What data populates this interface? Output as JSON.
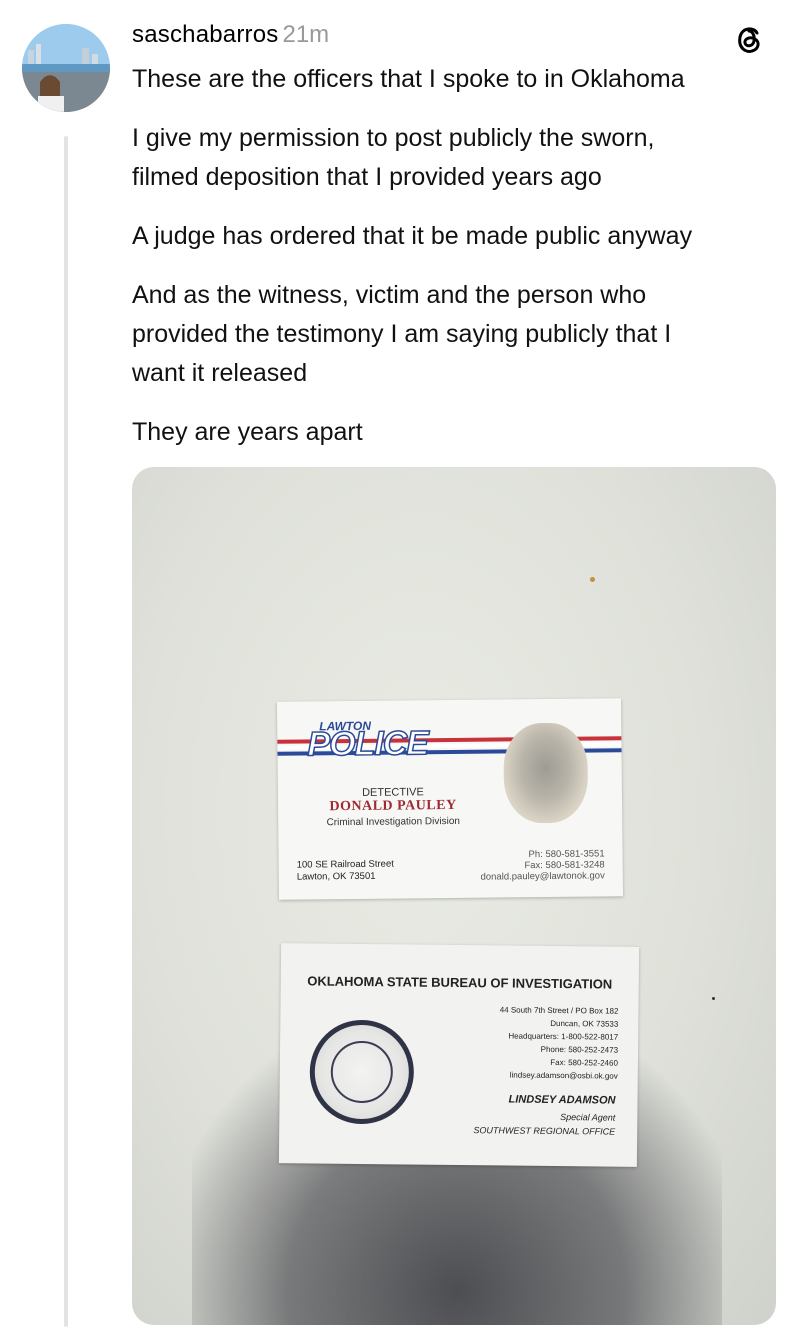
{
  "post": {
    "username": "saschabarros",
    "time": "21m",
    "paragraphs": [
      "These are the officers that I spoke to in Oklahoma",
      "I give my permission to post publicly the sworn,\nfilmed deposition that I provided years ago",
      "A judge has ordered that it be made public anyway",
      "And as the witness, victim and the person who\nprovided the testimony I am saying publicly that I\nwant it released",
      "They are years apart"
    ]
  },
  "icons": {
    "avatar": "user-avatar",
    "app": "threads-icon"
  },
  "photo": {
    "card1": {
      "logo_small": "LAWTON",
      "logo_big": "POLICE",
      "title": "DETECTIVE",
      "name": "DONALD PAULEY",
      "division": "Criminal Investigation Division",
      "address": "100 SE Railroad Street\nLawton, OK 73501",
      "contact": "Ph: 580-581-3551\nFax: 580-581-3248\ndonald.pauley@lawtonok.gov"
    },
    "card2": {
      "heading": "OKLAHOMA STATE BUREAU OF INVESTIGATION",
      "address": "44 South 7th Street / PO Box 182\nDuncan, OK 73533\nHeadquarters: 1-800-522-8017\nPhone: 580-252-2473\nFax: 580-252-2460\nlindsey.adamson@osbi.ok.gov",
      "name": "LINDSEY ADAMSON",
      "role": "Special Agent",
      "office": "SOUTHWEST REGIONAL OFFICE"
    }
  },
  "colors": {
    "police_blue": "#2b4b9a",
    "police_red": "#c8323a",
    "name_red": "#a02a33"
  }
}
